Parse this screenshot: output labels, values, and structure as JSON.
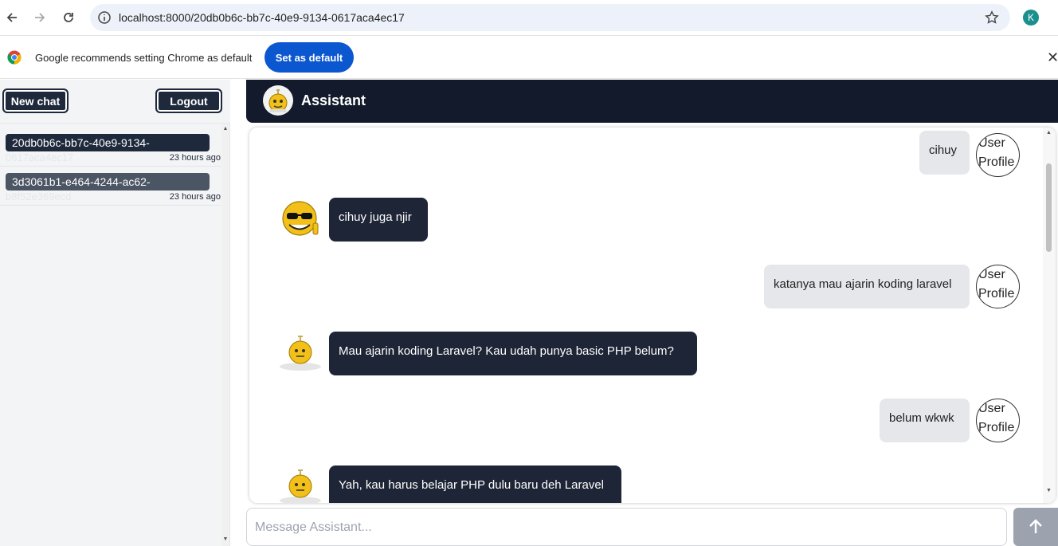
{
  "browser": {
    "url": "localhost:8000/20db0b6c-bb7c-40e9-9134-0617aca4ec17",
    "profile_initial": "K"
  },
  "infobar": {
    "message": "Google recommends setting Chrome as default",
    "button_label": "Set as default",
    "close_glyph": "✕"
  },
  "sidebar": {
    "new_chat_label": "New chat",
    "logout_label": "Logout",
    "chats": [
      {
        "id_line1": "20db0b6c-bb7c-40e9-9134-",
        "id_line2": "0617aca4ec17",
        "time": "23 hours ago",
        "active": true
      },
      {
        "id_line1": "3d3061b1-e464-4244-ac62-",
        "id_line2": "b8f52e369ecd",
        "time": "23 hours ago",
        "active": false
      }
    ]
  },
  "header": {
    "title": "Assistant"
  },
  "messages": [
    {
      "role": "user",
      "text": "cihuy",
      "avatar_alt": "User Profile"
    },
    {
      "role": "bot",
      "text": "cihuy juga njir"
    },
    {
      "role": "user",
      "text": "katanya mau ajarin koding laravel",
      "avatar_alt": "User Profile"
    },
    {
      "role": "bot",
      "text": "Mau ajarin koding Laravel? Kau udah punya basic PHP belum?"
    },
    {
      "role": "user",
      "text": "belum wkwk",
      "avatar_alt": "User Profile"
    },
    {
      "role": "bot",
      "text": "Yah, kau harus belajar PHP dulu baru deh Laravel"
    }
  ],
  "composer": {
    "placeholder": "Message Assistant..."
  },
  "colors": {
    "header_bg": "#121a2b",
    "bot_bubble": "#1e2536",
    "user_bubble": "#e5e7eb",
    "chrome_blue": "#0b57d0"
  }
}
